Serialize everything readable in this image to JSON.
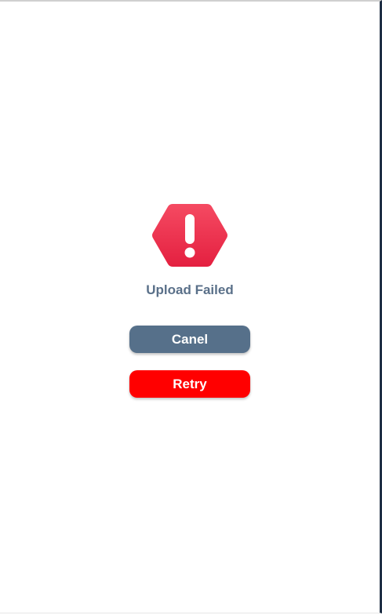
{
  "dialog": {
    "title": "Upload Failed",
    "icon": "error-octagon-exclamation-icon",
    "cancel_label": "Canel",
    "retry_label": "Retry"
  },
  "colors": {
    "icon_top": "#f54a62",
    "icon_bottom": "#e42040",
    "title": "#5a7089",
    "cancel_button": "#56708a",
    "retry_button": "#ff0000"
  }
}
